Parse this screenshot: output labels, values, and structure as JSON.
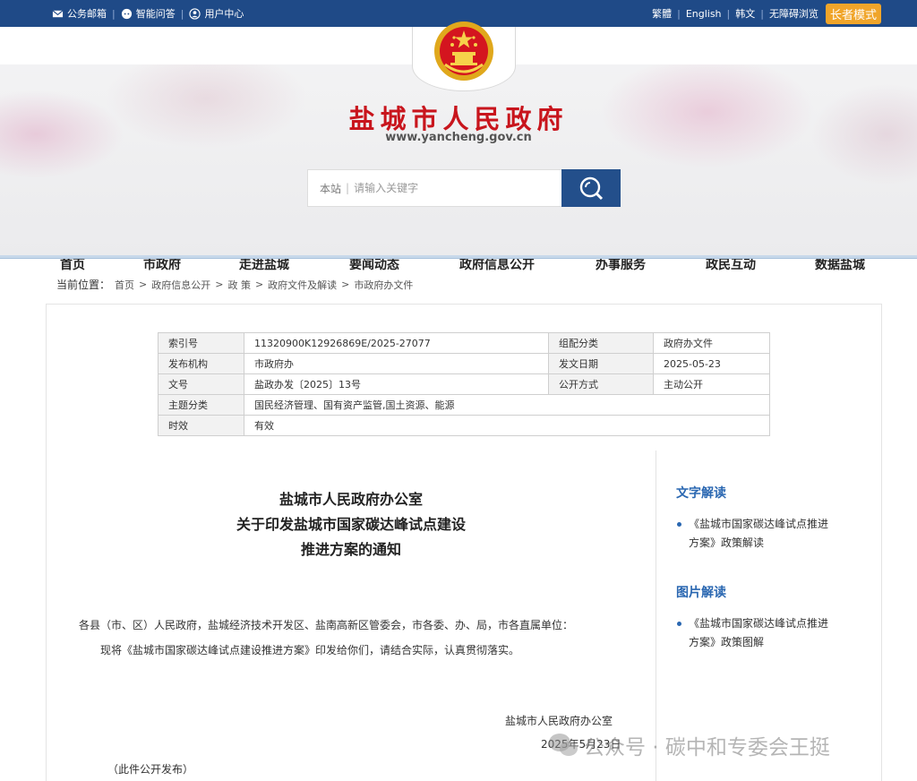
{
  "topbar": {
    "left": [
      {
        "label": "公务邮箱",
        "icon": "mail-icon"
      },
      {
        "label": "智能问答",
        "icon": "chat-bot-icon"
      },
      {
        "label": "用户中心",
        "icon": "user-icon"
      }
    ],
    "right": [
      "繁體",
      "English",
      "韩文",
      "无障碍浏览"
    ],
    "elder_mode": "长者模式"
  },
  "header": {
    "title": "盐城市人民政府",
    "url": "www.yancheng.gov.cn"
  },
  "search": {
    "scope": "本站",
    "placeholder": "请输入关键字",
    "value": ""
  },
  "nav": [
    "首页",
    "市政府",
    "走进盐城",
    "要闻动态",
    "政府信息公开",
    "办事服务",
    "政民互动",
    "数据盐城"
  ],
  "breadcrumb": {
    "lead": "当前位置：",
    "items": [
      "首页",
      "政府信息公开",
      "政 策",
      "政府文件及解读",
      "市政府办文件"
    ],
    "separator": ">"
  },
  "meta": {
    "index_label": "索引号",
    "index_value": "11320900K12926869E/2025-27077",
    "category_label": "组配分类",
    "category_value": "政府办文件",
    "org_label": "发布机构",
    "org_value": "市政府办",
    "date_label": "发文日期",
    "date_value": "2025-05-23",
    "docno_label": "文号",
    "docno_value": "盐政办发〔2025〕13号",
    "publish_label": "公开方式",
    "publish_value": "主动公开",
    "topic_label": "主题分类",
    "topic_value": "国民经济管理、国有资产监管,国土资源、能源",
    "validity_label": "时效",
    "validity_value": "有效"
  },
  "document": {
    "title_line1": "盐城市人民政府办公室",
    "title_line2": "关于印发盐城市国家碳达峰试点建设",
    "title_line3": "推进方案的通知",
    "body_line1": "各县（市、区）人民政府，盐城经济技术开发区、盐南高新区管委会，市各委、办、局，市各直属单位：",
    "body_line2": "现将《盐城市国家碳达峰试点建设推进方案》印发给你们，请结合实际，认真贯彻落实。",
    "signature": "盐城市人民政府办公室",
    "date": "2025年5月23日",
    "note": "（此件公开发布）"
  },
  "sidebar": {
    "text_heading": "文字解读",
    "text_item": "《盐城市国家碳达峰试点推进方案》政策解读",
    "image_heading": "图片解读",
    "image_item": "《盐城市国家碳达峰试点推进方案》政策图解"
  },
  "watermark": "公众号 · 碳中和专委会王挺",
  "colors": {
    "topbar": "#1f4a87",
    "title_red": "#c8151d",
    "elder_btn": "#f0a52a",
    "search_btn": "#234f8b",
    "side_heading": "#2a67b1"
  }
}
